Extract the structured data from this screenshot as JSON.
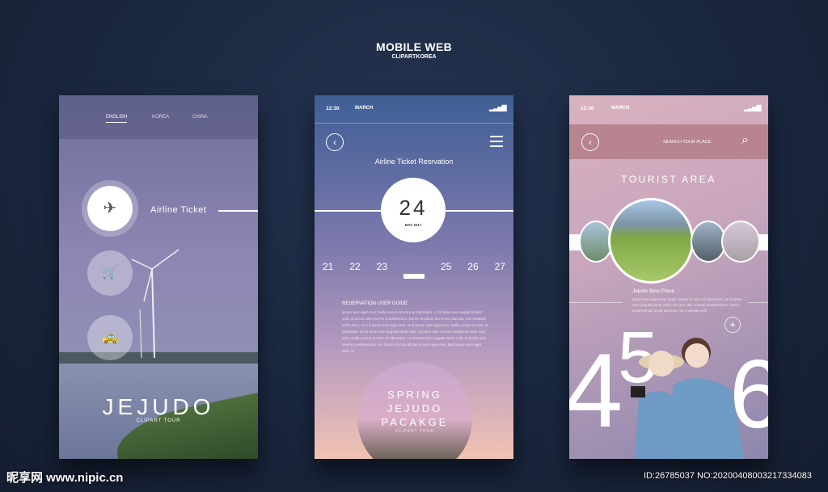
{
  "header": {
    "title": "MOBILE WEB",
    "subtitle": "CLIPARTKOREA"
  },
  "screen1": {
    "languages": [
      "ENGLISH",
      "KOREA",
      "CHINA"
    ],
    "active_language": "ENGLISH",
    "menu": [
      {
        "icon": "airplane-icon",
        "label": "Airline Ticket"
      },
      {
        "icon": "cart-icon",
        "label": ""
      },
      {
        "icon": "car-icon",
        "label": ""
      }
    ],
    "brand": "JEJUDO",
    "brand_sub": "CLIPART TOUR"
  },
  "screen2": {
    "time": "12:30",
    "month": "MARCH",
    "title": "Airline Ticket Resrvation",
    "day": "24",
    "month_year": "MAY 2017",
    "dates": [
      "21",
      "22",
      "23",
      "",
      "25",
      "26",
      "27"
    ],
    "guide_title": "RESERVATION USER GUIDE",
    "guide_text": "ipsum sem eget eros. Nulla cursus at enim at bibendum. Ut sit amet sem augutincidunt velit, ut luctus odio viverra condimentum. Donec tincidunt dui id est placerat, non molestie velit luctus. Ut a d ipsum sem eget eros. Nud ipsum sem eget eros. Nulla cursus at enim at bibendum. Ut sit amet sem augutincidunt velit, ut luctus odio viverra condipsum sem eget eros. Nulla cursus at enim at bibendum. Ut sit amet sem augutincidunt velit, ut luctus odio viverra condimentum. en- Donec tincidunttl ipsum sem eget eros. Nud ipsum sem eget eros. N",
    "package_lines": [
      "SPRING",
      "JEJUDO",
      "PACAKGE"
    ],
    "package_sub": "CLIPART TOUR"
  },
  "screen3": {
    "time": "12:30",
    "month": "MARCH",
    "search_placeholder": "SEARCH TOUR PLACE",
    "section_title": "TOURIST AREA",
    "place_title": "Jejudo Best Place",
    "place_text": "ipsum sem eget eros. Nulla cursus at enim at bibendum. Ut sit amet sem augutincidunt velit, ut luctus odio viverra condimentum. Donec tincid-unt dui id est placerat, non molestie velit",
    "big_numbers": [
      "4",
      "5",
      "6"
    ]
  },
  "watermark": {
    "site": "昵享网 www.nipic.cn",
    "id": "ID:26785037 NO:20200408003217334083"
  }
}
